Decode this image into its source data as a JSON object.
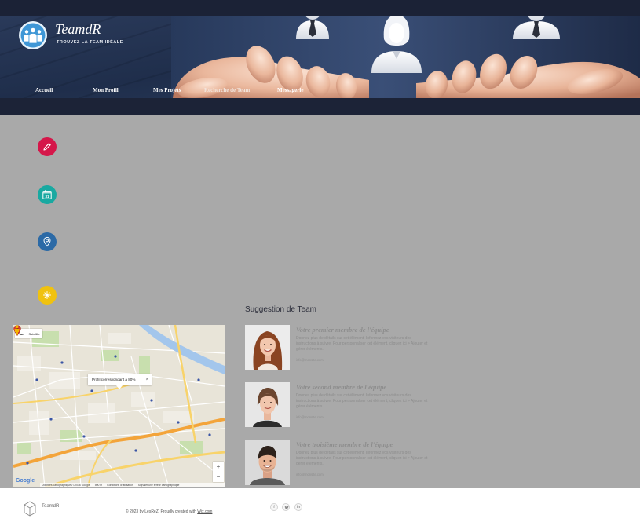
{
  "header": {
    "brand": "TeamdR",
    "tagline": "TROUVEZ LA TEAM IDÉALE",
    "logo_icon": "team-people-icon",
    "nav": [
      {
        "label": "Accueil"
      },
      {
        "label": "Mon Profil"
      },
      {
        "label": "Mes Projets"
      },
      {
        "label": "Recherche de Team"
      },
      {
        "label": "Messagerie"
      }
    ]
  },
  "feature_icons": [
    {
      "icon": "pencil-icon",
      "color": "#d5174a"
    },
    {
      "icon": "calendar-icon",
      "color": "#19a9a1",
      "day": "31"
    },
    {
      "icon": "location-pin-icon",
      "color": "#2c6aa6"
    },
    {
      "icon": "sun-icon",
      "color": "#f0c20f"
    }
  ],
  "map": {
    "map_type": [
      "Plan",
      "Satellite"
    ],
    "info_window": "Profil correspondant à 80%",
    "close_symbol": "×",
    "zoom_in": "+",
    "zoom_out": "−",
    "logo": "Google",
    "attribution": "Données cartographiques ©2016 Google",
    "scale": "500 m",
    "terms": "Conditions d'utilisation",
    "report": "Signaler une erreur cartographique"
  },
  "team": {
    "heading": "Suggestion de Team",
    "members": [
      {
        "title": "Votre premier membre de l'équipe",
        "description": "Donnez plus de détails sur cet élément. Informez vos visiteurs des instructions à suivre. Pour personnaliser cet élément, cliquez ici > Ajouter et gérer éléments.",
        "email": "info@monsite.com"
      },
      {
        "title": "Votre second membre de l'équipe",
        "description": "Donnez plus de détails sur cet élément. Informez vos visiteurs des instructions à suivre. Pour personnaliser cet élément, cliquez ici > Ajouter et gérer éléments.",
        "email": "info@monsite.com"
      },
      {
        "title": "Votre troisième membre de l'équipe",
        "description": "Donnez plus de détails sur cet élément. Informez vos visiteurs des instructions à suivre. Pour personnaliser cet élément, cliquez ici > Ajouter et gérer éléments.",
        "email": "info@monsite.com"
      }
    ]
  },
  "footer": {
    "brand": "TeamdR",
    "copyright": "© 2023 by LesReZ. Proudly created with ",
    "link": "Wix.com",
    "social": [
      {
        "icon": "facebook-icon",
        "label": "f"
      },
      {
        "icon": "twitter-icon"
      },
      {
        "icon": "linkedin-icon",
        "label": "in"
      }
    ]
  },
  "colors": {
    "header_bg": "#1b2236",
    "body_bg": "#a9a9a9",
    "footer_bg": "#ffffff",
    "marker": "#d93a2f"
  }
}
